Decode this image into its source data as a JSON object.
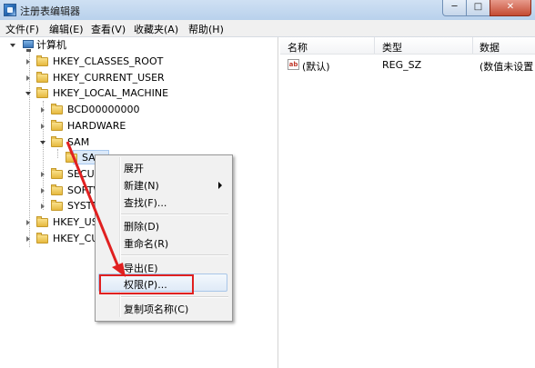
{
  "window": {
    "title": "注册表编辑器",
    "controls": {
      "minimize": "─",
      "maximize": "□",
      "close": "✕"
    }
  },
  "menubar": {
    "items": [
      "文件(F)",
      "编辑(E)",
      "查看(V)",
      "收藏夹(A)",
      "帮助(H)"
    ]
  },
  "tree": {
    "root": "计算机",
    "nodes": {
      "hkcr": "HKEY_CLASSES_ROOT",
      "hkcu": "HKEY_CURRENT_USER",
      "hklm": "HKEY_LOCAL_MACHINE",
      "bcd": "BCD00000000",
      "hardware": "HARDWARE",
      "sam": "SAM",
      "sam_child": "SA",
      "security": "SECUR",
      "software": "SOFTW",
      "system": "SYSTE",
      "hku": "HKEY_US",
      "hkcc": "HKEY_CU"
    }
  },
  "list": {
    "columns": [
      "名称",
      "类型",
      "数据"
    ],
    "rows": [
      {
        "name": "(默认)",
        "type": "REG_SZ",
        "data": "(数值未设置"
      }
    ]
  },
  "context_menu": {
    "items": {
      "expand": "展开",
      "new": "新建(N)",
      "find": "查找(F)...",
      "delete": "删除(D)",
      "rename": "重命名(R)",
      "export": "导出(E)",
      "permissions": "权限(P)...",
      "copy_key_name": "复制项名称(C)"
    },
    "highlighted": "权限(P)..."
  },
  "colors": {
    "annotation": "#e02020",
    "selection": "#dbe9f9"
  },
  "icons": [
    "app-icon",
    "computer-icon",
    "folder-icon",
    "string-value-icon",
    "submenu-arrow-icon"
  ]
}
